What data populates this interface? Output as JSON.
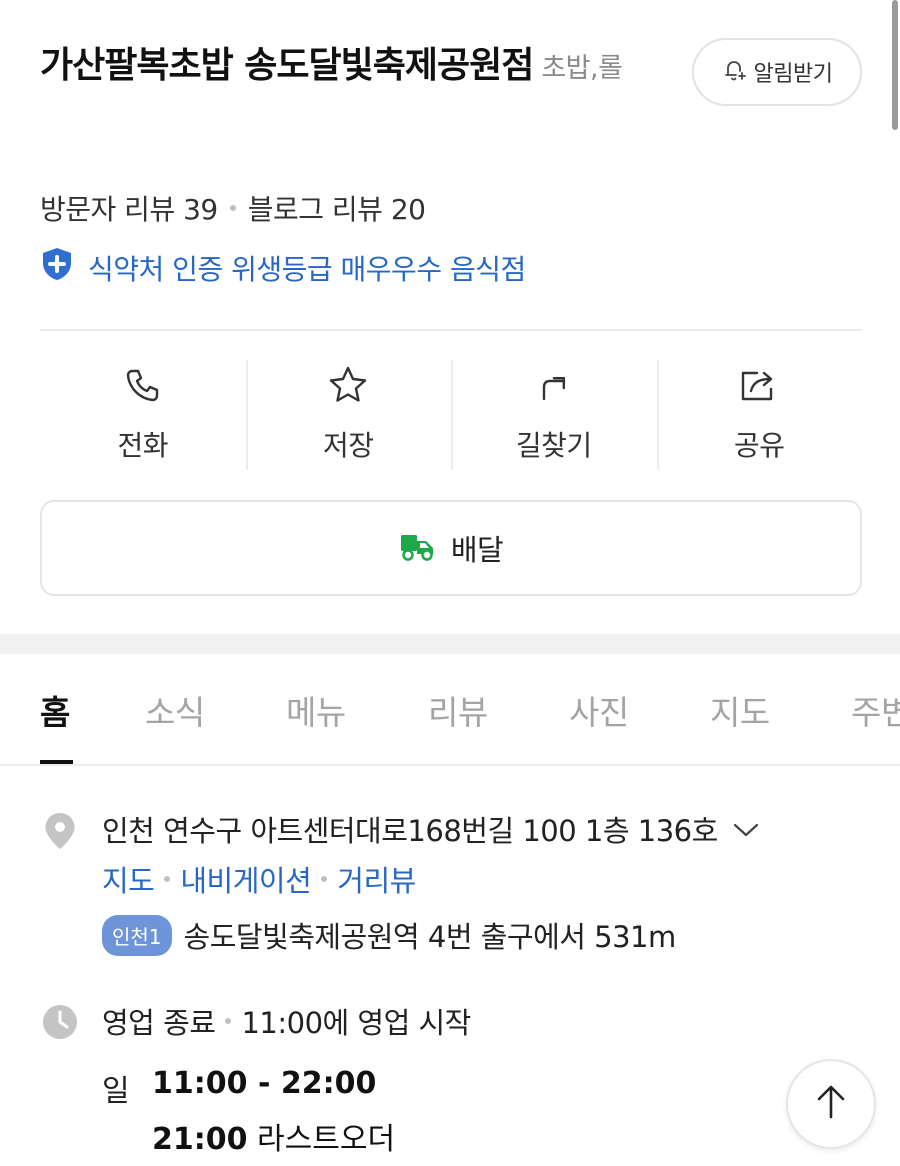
{
  "place": {
    "name": "가산팔복초밥 송도달빛축제공원점",
    "category": "초밥,롤",
    "visitor_reviews": "방문자 리뷰 39",
    "blog_reviews": "블로그 리뷰 20",
    "certification": "식약처 인증 위생등급 매우우수 음식점"
  },
  "alarm_button": {
    "label": "알림받기",
    "icon": "bell-plus-icon"
  },
  "actions": [
    {
      "label": "전화",
      "icon": "phone-icon"
    },
    {
      "label": "저장",
      "icon": "star-icon"
    },
    {
      "label": "길찾기",
      "icon": "directions-icon"
    },
    {
      "label": "공유",
      "icon": "share-icon"
    }
  ],
  "delivery": {
    "label": "배달",
    "icon": "delivery-truck-icon",
    "icon_color": "#1ea84a"
  },
  "tabs": [
    {
      "label": "홈",
      "active": true
    },
    {
      "label": "소식"
    },
    {
      "label": "메뉴"
    },
    {
      "label": "리뷰"
    },
    {
      "label": "사진"
    },
    {
      "label": "지도"
    },
    {
      "label": "주변"
    }
  ],
  "address": {
    "text": "인천 연수구 아트센터대로168번길 100 1층 136호",
    "links": [
      "지도",
      "내비게이션",
      "거리뷰"
    ],
    "subway_badge": "인천1",
    "subway_text": "송도달빛축제공원역 4번 출구에서 531m"
  },
  "hours": {
    "status": "영업 종료",
    "next": "11:00에 영업 시작",
    "day": "일",
    "time": "11:00 - 22:00",
    "last_order_time": "21:00",
    "last_order_label": "라스트오더"
  },
  "colors": {
    "link": "#2767c7",
    "badge": "#6e95d9",
    "delivery": "#1ea84a"
  }
}
